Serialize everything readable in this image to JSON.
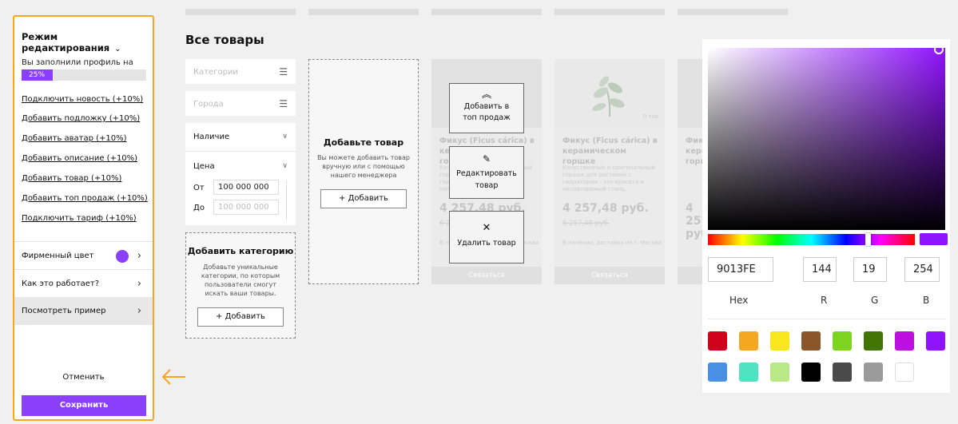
{
  "sidebar": {
    "title": "Режим редактирования",
    "fill_text": "Вы заполнили профиль на",
    "progress": 0.25,
    "progress_label": "25%",
    "links": [
      "Подключить новость (+10%)",
      "Добавить подложку (+10%)",
      "Добавить аватар (+10%)",
      "Добавить описание (+10%)",
      "Добавить товар (+10%)",
      "Добавить топ продаж (+10%)",
      "Подключить тариф (+10%)"
    ],
    "brand_color_label": "Фирменный цвет",
    "brand_color": "#8a3ffc",
    "how_label": "Как это работает?",
    "example_label": "Посмотреть пример",
    "cancel_label": "Отменить",
    "save_label": "Сохранить",
    "border_color": "#f5a623"
  },
  "main": {
    "title": "Все товары",
    "filters": {
      "categories_placeholder": "Категории",
      "cities_placeholder": "Города",
      "availability_label": "Наличие",
      "price_label": "Цена",
      "from_label": "От",
      "from_value": "100 000 000",
      "to_label": "До",
      "to_placeholder": "100 000 000"
    },
    "add_category": {
      "title": "Добавить категорию",
      "desc": "Добавьте уникальные категории, по которым пользователи смогут искать ваши товары.",
      "button": "+ Добавить"
    },
    "add_product": {
      "title": "Добавьте товар",
      "desc": "Вы можете добавить товар вручную или с помощью нашего менеджера",
      "button": "+ Добавить"
    },
    "card": {
      "name": "Фикус (Ficus cárica) в керамическом горшке",
      "desc": "Качественный и оригинальный горшок для растений с гидратором - это красота и неповторимый стиль.",
      "price": "4 257,48 руб.",
      "old_price": "6 257,48 руб.",
      "availability": "В наличии, доставка из г. Москва",
      "button": "Связаться",
      "badge": "0 тов"
    },
    "overlay": {
      "top_label": "Добавить в топ продаж",
      "edit_label": "Редактировать товар",
      "delete_label": "Удалить товар"
    }
  },
  "picker": {
    "hex": "9013FE",
    "r": "144",
    "g": "19",
    "b": "254",
    "hex_label": "Hex",
    "r_label": "R",
    "g_label": "G",
    "b_label": "B",
    "hue_position": 0.78,
    "swatches": [
      "#d0021b",
      "#f5a623",
      "#f8e71c",
      "#8b572a",
      "#7ed321",
      "#417505",
      "#bd10e0",
      "#9013fe",
      "#4a90e2",
      "#50e3c2",
      "#b8e986",
      "#000000",
      "#4a4a4a",
      "#9b9b9b",
      "#ffffff"
    ]
  }
}
